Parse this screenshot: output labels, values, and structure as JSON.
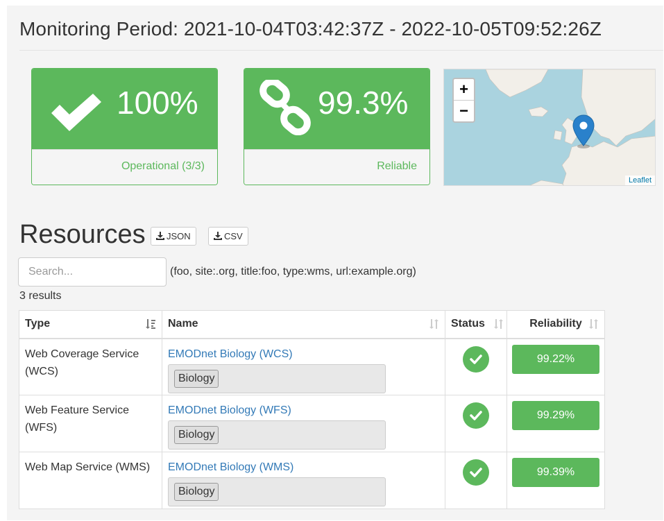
{
  "header": {
    "period": "Monitoring Period: 2021-10-04T03:42:37Z - 2022-10-05T09:52:26Z"
  },
  "stats": {
    "operational": {
      "value": "100%",
      "label": "Operational (3/3)",
      "icon": "check-icon"
    },
    "reliable": {
      "value": "99.3%",
      "label": "Reliable",
      "icon": "link-icon"
    }
  },
  "map": {
    "zoom_in": "+",
    "zoom_out": "−",
    "attribution": "Leaflet",
    "marker_icon": "map-marker-icon"
  },
  "resources": {
    "title": "Resources",
    "json_btn": "JSON",
    "csv_btn": "CSV",
    "search_placeholder": "Search...",
    "hint": "(foo, site:.org, title:foo, type:wms, url:example.org)",
    "count": "3 results",
    "columns": [
      "Type",
      "Name",
      "Status",
      "Reliability"
    ],
    "rows": [
      {
        "type": "Web Coverage Service (WCS)",
        "name": "EMODnet Biology (WCS)",
        "keyword": "Biology",
        "status": "ok",
        "reliability": "99.22%"
      },
      {
        "type": "Web Feature Service (WFS)",
        "name": "EMODnet Biology (WFS)",
        "keyword": "Biology",
        "status": "ok",
        "reliability": "99.29%"
      },
      {
        "type": "Web Map Service (WMS)",
        "name": "EMODnet Biology (WMS)",
        "keyword": "Biology",
        "status": "ok",
        "reliability": "99.39%"
      }
    ]
  },
  "colors": {
    "success": "#5cb85c",
    "link": "#337ab7",
    "map_sea": "#aad3df",
    "map_land": "#f2efe9",
    "marker": "#2a81cb"
  }
}
